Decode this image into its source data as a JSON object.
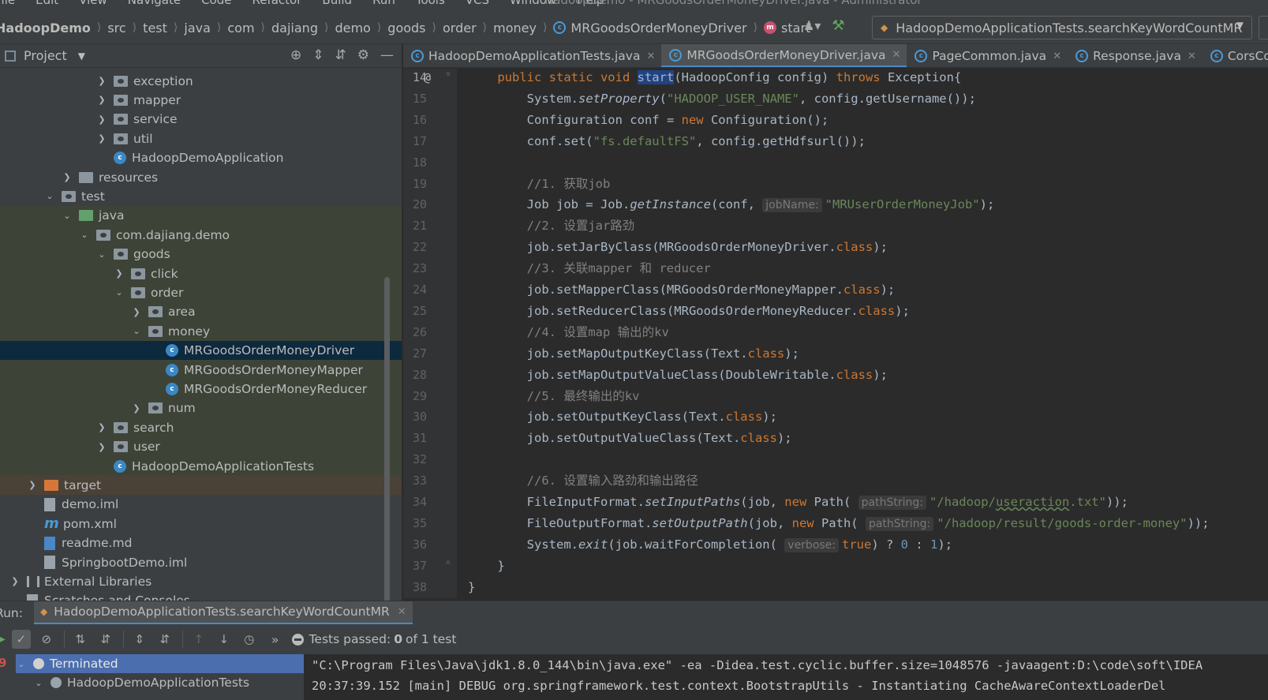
{
  "menu": [
    "File",
    "Edit",
    "View",
    "Navigate",
    "Code",
    "Refactor",
    "Build",
    "Run",
    "Tools",
    "VCS",
    "Window",
    "Help"
  ],
  "window_title": "HadoopDemo - MRGoodsOrderMoneyDriver.java - Administrator",
  "breadcrumbs": [
    "HadoopDemo",
    "src",
    "test",
    "java",
    "com",
    "dajiang",
    "demo",
    "goods",
    "order",
    "money",
    "MRGoodsOrderMoneyDriver",
    "start"
  ],
  "run_config": "HadoopDemoApplicationTests.searchKeyWordCountMR",
  "project_panel": {
    "title": "Project",
    "tree": [
      {
        "label": "exception",
        "kind": "folder",
        "depth": 5,
        "arrow": "right"
      },
      {
        "label": "mapper",
        "kind": "folder",
        "depth": 5,
        "arrow": "right"
      },
      {
        "label": "service",
        "kind": "folder",
        "depth": 5,
        "arrow": "right"
      },
      {
        "label": "util",
        "kind": "folder",
        "depth": 5,
        "arrow": "right"
      },
      {
        "label": "HadoopDemoApplication",
        "kind": "class",
        "depth": 5,
        "arrow": ""
      },
      {
        "label": "resources",
        "kind": "resfolder",
        "depth": 3,
        "arrow": "right"
      },
      {
        "label": "test",
        "kind": "folder",
        "depth": 2,
        "arrow": "down"
      },
      {
        "label": "java",
        "kind": "greenfolder",
        "depth": 3,
        "arrow": "down",
        "bg": "green"
      },
      {
        "label": "com.dajiang.demo",
        "kind": "folder",
        "depth": 4,
        "arrow": "down",
        "bg": "green"
      },
      {
        "label": "goods",
        "kind": "folder",
        "depth": 5,
        "arrow": "down",
        "bg": "green"
      },
      {
        "label": "click",
        "kind": "folder",
        "depth": 6,
        "arrow": "right",
        "bg": "green"
      },
      {
        "label": "order",
        "kind": "folder",
        "depth": 6,
        "arrow": "down",
        "bg": "green"
      },
      {
        "label": "area",
        "kind": "folder",
        "depth": 7,
        "arrow": "right",
        "bg": "green"
      },
      {
        "label": "money",
        "kind": "folder",
        "depth": 7,
        "arrow": "down",
        "bg": "green"
      },
      {
        "label": "MRGoodsOrderMoneyDriver",
        "kind": "class",
        "depth": 8,
        "arrow": "",
        "bg": "sel"
      },
      {
        "label": "MRGoodsOrderMoneyMapper",
        "kind": "class",
        "depth": 8,
        "arrow": "",
        "bg": "green"
      },
      {
        "label": "MRGoodsOrderMoneyReducer",
        "kind": "class",
        "depth": 8,
        "arrow": "",
        "bg": "green"
      },
      {
        "label": "num",
        "kind": "folder",
        "depth": 7,
        "arrow": "right",
        "bg": "green"
      },
      {
        "label": "search",
        "kind": "folder",
        "depth": 5,
        "arrow": "right",
        "bg": "green"
      },
      {
        "label": "user",
        "kind": "folder",
        "depth": 5,
        "arrow": "right",
        "bg": "green"
      },
      {
        "label": "HadoopDemoApplicationTests",
        "kind": "class",
        "depth": 5,
        "arrow": "",
        "bg": "green"
      },
      {
        "label": "target",
        "kind": "orangefolder",
        "depth": 1,
        "arrow": "right",
        "bg": "orange"
      },
      {
        "label": "demo.iml",
        "kind": "file",
        "depth": 1,
        "arrow": ""
      },
      {
        "label": "pom.xml",
        "kind": "maven",
        "depth": 1,
        "arrow": ""
      },
      {
        "label": "readme.md",
        "kind": "md",
        "depth": 1,
        "arrow": ""
      },
      {
        "label": "SpringbootDemo.iml",
        "kind": "file",
        "depth": 1,
        "arrow": ""
      },
      {
        "label": "External Libraries",
        "kind": "lib",
        "depth": 0,
        "arrow": "right"
      },
      {
        "label": "Scratches and Consoles",
        "kind": "file",
        "depth": 0,
        "arrow": ""
      }
    ]
  },
  "editor_tabs": [
    {
      "label": "HadoopDemoApplicationTests.java",
      "active": false
    },
    {
      "label": "MRGoodsOrderMoneyDriver.java",
      "active": true
    },
    {
      "label": "PageCommon.java",
      "active": false
    },
    {
      "label": "Response.java",
      "active": false
    },
    {
      "label": "CorsConfig",
      "active": false
    }
  ],
  "code": {
    "line_numbers": [
      "14",
      "15",
      "16",
      "17",
      "18",
      "19",
      "20",
      "21",
      "22",
      "23",
      "24",
      "25",
      "26",
      "27",
      "28",
      "29",
      "30",
      "31",
      "32",
      "33",
      "34",
      "35",
      "36",
      "37",
      "38"
    ],
    "lines": [
      [
        [
          "kw",
          "    public static void "
        ],
        [
          "hl",
          "start"
        ],
        [
          "p",
          "(HadoopConfig config) "
        ],
        [
          "kw",
          "throws "
        ],
        [
          "p",
          "Exception{"
        ]
      ],
      [
        [
          "p",
          "        System."
        ],
        [
          "it",
          "setProperty"
        ],
        [
          "p",
          "("
        ],
        [
          "str",
          "\"HADOOP_USER_NAME\""
        ],
        [
          "p",
          ", config.getUsername());"
        ]
      ],
      [
        [
          "p",
          "        Configuration conf = "
        ],
        [
          "kw",
          "new "
        ],
        [
          "p",
          "Configuration();"
        ]
      ],
      [
        [
          "p",
          "        conf.set("
        ],
        [
          "str",
          "\"fs.defaultFS\""
        ],
        [
          "p",
          ", config.getHdfsurl());"
        ]
      ],
      [],
      [
        [
          "cm",
          "        //1. 获取job"
        ]
      ],
      [
        [
          "p",
          "        Job job = Job."
        ],
        [
          "it",
          "getInstance"
        ],
        [
          "p",
          "(conf, "
        ],
        [
          "hint",
          "jobName:"
        ],
        [
          "str",
          "\"MRUserOrderMoneyJob\""
        ],
        [
          "p",
          ");"
        ]
      ],
      [
        [
          "cm",
          "        //2. 设置jar路劲"
        ]
      ],
      [
        [
          "p",
          "        job.setJarByClass(MRGoodsOrderMoneyDriver."
        ],
        [
          "kw",
          "class"
        ],
        [
          "p",
          ");"
        ]
      ],
      [
        [
          "cm",
          "        //3. 关联mapper 和 reducer"
        ]
      ],
      [
        [
          "p",
          "        job.setMapperClass(MRGoodsOrderMoneyMapper."
        ],
        [
          "kw",
          "class"
        ],
        [
          "p",
          ");"
        ]
      ],
      [
        [
          "p",
          "        job.setReducerClass(MRGoodsOrderMoneyReducer."
        ],
        [
          "kw",
          "class"
        ],
        [
          "p",
          ");"
        ]
      ],
      [
        [
          "cm",
          "        //4. 设置map 输出的kv"
        ]
      ],
      [
        [
          "p",
          "        job.setMapOutputKeyClass(Text."
        ],
        [
          "kw",
          "class"
        ],
        [
          "p",
          ");"
        ]
      ],
      [
        [
          "p",
          "        job.setMapOutputValueClass(DoubleWritable."
        ],
        [
          "kw",
          "class"
        ],
        [
          "p",
          ");"
        ]
      ],
      [
        [
          "cm",
          "        //5. 最终输出的kv"
        ]
      ],
      [
        [
          "p",
          "        job.setOutputKeyClass(Text."
        ],
        [
          "kw",
          "class"
        ],
        [
          "p",
          ");"
        ]
      ],
      [
        [
          "p",
          "        job.setOutputValueClass(Text."
        ],
        [
          "kw",
          "class"
        ],
        [
          "p",
          ");"
        ]
      ],
      [],
      [
        [
          "cm",
          "        //6. 设置输入路劲和输出路径"
        ]
      ],
      [
        [
          "p",
          "        FileInputFormat."
        ],
        [
          "it",
          "setInputPaths"
        ],
        [
          "p",
          "(job, "
        ],
        [
          "kw",
          "new "
        ],
        [
          "p",
          "Path( "
        ],
        [
          "hint",
          "pathString:"
        ],
        [
          "str",
          "\"/hadoop/"
        ],
        [
          "ul",
          "useraction"
        ],
        [
          "str",
          ".txt\""
        ],
        [
          "p",
          "));"
        ]
      ],
      [
        [
          "p",
          "        FileOutputFormat."
        ],
        [
          "it",
          "setOutputPath"
        ],
        [
          "p",
          "(job, "
        ],
        [
          "kw",
          "new "
        ],
        [
          "p",
          "Path( "
        ],
        [
          "hint",
          "pathString:"
        ],
        [
          "str",
          "\"/hadoop/result/goods-order-money\""
        ],
        [
          "p",
          "));"
        ]
      ],
      [
        [
          "p",
          "        System."
        ],
        [
          "it",
          "exit"
        ],
        [
          "p",
          "(job.waitForCompletion( "
        ],
        [
          "hint",
          "verbose:"
        ],
        [
          "kw",
          "true"
        ],
        [
          "p",
          ") ? "
        ],
        [
          "num",
          "0"
        ],
        [
          "p",
          " : "
        ],
        [
          "num",
          "1"
        ],
        [
          "p",
          ");"
        ]
      ],
      [
        [
          "p",
          "    }"
        ]
      ],
      [
        [
          "p",
          "}"
        ]
      ]
    ]
  },
  "run_panel": {
    "label": "Run:",
    "tab": "HadoopDemoApplicationTests.searchKeyWordCountMR",
    "status_prefix": "Tests passed: ",
    "status_count": "0",
    "status_suffix": " of 1 test",
    "tree": [
      "Terminated",
      "HadoopDemoApplicationTests"
    ],
    "console": [
      "\"C:\\Program Files\\Java\\jdk1.8.0_144\\bin\\java.exe\" -ea -Didea.test.cyclic.buffer.size=1048576 -javaagent:D:\\code\\soft\\IDEA",
      "20:37:39.152 [main] DEBUG org.springframework.test.context.BootstrapUtils - Instantiating CacheAwareContextLoaderDel"
    ]
  }
}
